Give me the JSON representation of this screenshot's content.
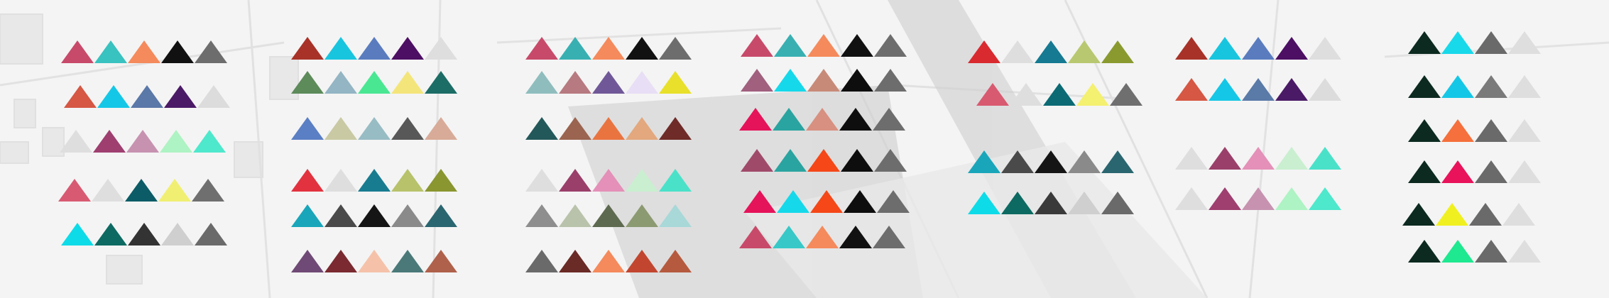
{
  "palette_groups": [
    {
      "rows": [
        [
          "#c84a6a",
          "#38c2c0",
          "#f58a5c",
          "#111111",
          "#6d6d6d"
        ],
        [
          "#d55744",
          "#15c7e6",
          "#5a78a8",
          "#4a1a66",
          "#dcdcdc"
        ],
        [
          "#dedede",
          "#9e3f70",
          "#c792b0",
          "#aef3c3",
          "#4ee8cc"
        ],
        [
          "#d85a72",
          "#dedede",
          "#0b5c66",
          "#f0ef72",
          "#6f6f6f"
        ],
        [
          "#0edbe8",
          "#0c6a62",
          "#333333",
          "#cfcfcf",
          "#6a6a6a"
        ]
      ]
    },
    {
      "rows": [
        [
          "#a83228",
          "#18c5df",
          "#5a7cbf",
          "#4c0f63",
          "#dedede"
        ],
        [
          "#5d8b5a",
          "#93b5c4",
          "#4ae793",
          "#f4e57b",
          "#1c6d66"
        ],
        [
          "#5a7fc4",
          "#c9c9a4",
          "#98bcc4",
          "#585858",
          "#d8ab98"
        ],
        [
          "#e2323f",
          "#dedede",
          "#187c90",
          "#b7c26a",
          "#8a962f"
        ],
        [
          "#1aa6ba",
          "#4a4a4a",
          "#151515",
          "#8a8a8a",
          "#2a6670"
        ],
        [
          "#6f4a76",
          "#7a2a30",
          "#f5c2a9",
          "#4b7979",
          "#b0614b"
        ]
      ]
    },
    {
      "rows": [
        [
          "#c84a6a",
          "#38b0b2",
          "#f58a5c",
          "#111111",
          "#6d6d6d"
        ],
        [
          "#8fbdbe",
          "#b67a80",
          "#705898",
          "#e8def5",
          "#e8e02a"
        ],
        [
          "#23585a",
          "#9a6450",
          "#ea7440",
          "#e3a87e",
          "#6e2b28"
        ],
        [
          "#dedede",
          "#9a3f6a",
          "#e490b8",
          "#c9efd0",
          "#4ae1c9"
        ],
        [
          "#8e8e8e",
          "#b9c3ab",
          "#5d6a50",
          "#8c9a72",
          "#a8d8d8"
        ],
        [
          "#6a6a6a",
          "#6a2a25",
          "#f58a5c",
          "#c2462f",
          "#b55a3e"
        ]
      ]
    },
    {
      "rows": [
        [
          "#c84a6a",
          "#38b0b2",
          "#f58a5c",
          "#111111",
          "#6d6d6d"
        ],
        [
          "#a0607e",
          "#15d9ea",
          "#c88a78",
          "#0e0e0e",
          "#6d6d6d"
        ],
        [
          "#e5135a",
          "#2aa4a0",
          "#d89080",
          "#0e0e0e",
          "#6d6d6d"
        ],
        [
          "#a04a6a",
          "#2aa4a0",
          "#f54718",
          "#0e0e0e",
          "#6d6d6d"
        ],
        [
          "#e5135a",
          "#15d9ea",
          "#f54718",
          "#0e0e0e",
          "#6d6d6d"
        ],
        [
          "#c84a6a",
          "#38c8c8",
          "#f58a5c",
          "#111111",
          "#6d6d6d"
        ]
      ]
    },
    {
      "rows": [
        [
          "#d92a30",
          "#dedede",
          "#157a92",
          "#b8c870",
          "#8a9a2f"
        ],
        [
          "#d85a70",
          "#dedede",
          "#0b6a74",
          "#f4f070",
          "#6f6f6f"
        ],
        [
          "#1aa6ba",
          "#4a4a4a",
          "#151515",
          "#8a8a8a",
          "#2a6670"
        ],
        [
          "#0edbe8",
          "#0c6a62",
          "#3a3a3a",
          "#cfcfcf",
          "#6a6a6a"
        ]
      ]
    },
    {
      "rows": [
        [
          "#a83228",
          "#18c5df",
          "#5a7cbf",
          "#4c0f63",
          "#dedede"
        ],
        [
          "#d55744",
          "#15c7e6",
          "#5a7aa8",
          "#4a1a66",
          "#dcdcdc"
        ],
        [
          "#dedede",
          "#9a3f6a",
          "#e490b8",
          "#c9efd0",
          "#4ae1c9"
        ],
        [
          "#dedede",
          "#9e3f70",
          "#c792b0",
          "#aef3c3",
          "#4ee8cc"
        ]
      ]
    },
    {
      "rows": [
        [
          "#0c2a20",
          "#18d9ea",
          "#6a6a6a",
          "#dedede"
        ],
        [
          "#0c2a20",
          "#15c7e6",
          "#7a7a7a",
          "#dedede"
        ],
        [
          "#0c2a20",
          "#f5703c",
          "#6a6a6a",
          "#dedede"
        ],
        [
          "#0c2a20",
          "#e8135a",
          "#6a6a6a",
          "#dedede"
        ],
        [
          "#0c2a20",
          "#f0f020",
          "#6a6a6a",
          "#dedede"
        ],
        [
          "#0c2a20",
          "#1ee890",
          "#6a6a6a",
          "#dedede"
        ]
      ]
    }
  ]
}
